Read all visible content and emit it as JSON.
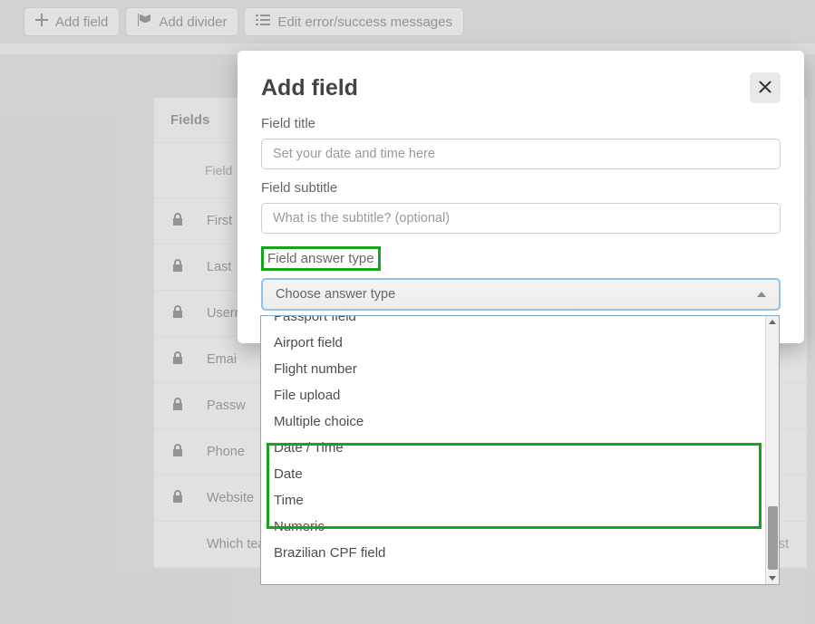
{
  "toolbar": {
    "add_field": "Add field",
    "add_divider": "Add divider",
    "edit_messages": "Edit error/success messages"
  },
  "panel": {
    "title": "Fields",
    "column_label": "Field",
    "rows": [
      {
        "locked": true,
        "label": "First"
      },
      {
        "locked": true,
        "label": "Last"
      },
      {
        "locked": true,
        "label": "Usern"
      },
      {
        "locked": true,
        "label": "Emai"
      },
      {
        "locked": true,
        "label": "Passw"
      },
      {
        "locked": true,
        "label": "Phone"
      },
      {
        "locked": true,
        "label": "Website"
      },
      {
        "locked": false,
        "label": "Which team do you belong to?",
        "right": "Options list"
      }
    ]
  },
  "modal": {
    "title": "Add field",
    "field_title_label": "Field title",
    "field_title_placeholder": "Set your date and time here",
    "field_subtitle_label": "Field subtitle",
    "field_subtitle_placeholder": "What is the subtitle? (optional)",
    "answer_type_label": "Field answer type",
    "select_placeholder": "Choose answer type"
  },
  "dropdown": {
    "options": [
      "Passport field",
      "Airport field",
      "Flight number",
      "File upload",
      "Multiple choice",
      "Date / Time",
      "Date",
      "Time",
      "Numeric",
      "Brazilian CPF field"
    ]
  }
}
